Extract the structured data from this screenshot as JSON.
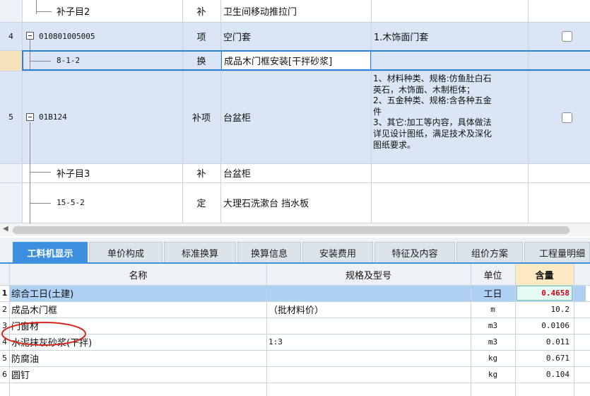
{
  "upper_rows": [
    {
      "index": "",
      "code": "补子目2",
      "type": "补",
      "name": "卫生间移动推拉门",
      "feature": ""
    },
    {
      "index": "4",
      "code": "010801005005",
      "type": "项",
      "name": "空门套",
      "feature": "1.木饰面门套"
    },
    {
      "index": "",
      "code": "8-1-2",
      "type": "换",
      "name": "成品木门框安装[干拌砂浆]",
      "feature": ""
    },
    {
      "index": "5",
      "code": "01B124",
      "type": "补项",
      "name": "台盆柜",
      "feature_lines": [
        "1、材料种类、规格:仿鱼肚白石",
        "英石，木饰面、木制柜体；",
        "2、五金种类、规格:含各种五金",
        "件",
        "3、其它:加工等内容，具体做法",
        "详见设计图纸，满足技术及深化",
        "图纸要求。"
      ]
    },
    {
      "index": "",
      "code": "补子目3",
      "type": "补",
      "name": "台盆柜",
      "feature": ""
    },
    {
      "index": "",
      "code": "15-5-2",
      "type": "定",
      "name": "大理石洗漱台 挡水板",
      "feature": ""
    }
  ],
  "tabs": [
    "工料机显示",
    "单价构成",
    "标准换算",
    "换算信息",
    "安装费用",
    "特征及内容",
    "组价方案",
    "工程量明细"
  ],
  "lower_headers": {
    "name": "名称",
    "spec": "规格及型号",
    "unit": "单位",
    "qty": "含量"
  },
  "lower_rows": [
    {
      "index": "1",
      "name": "综合工日(土建)",
      "spec": "",
      "unit": "工日",
      "qty": "0.4658"
    },
    {
      "index": "2",
      "name": "成品木门框",
      "spec": "（批材料价）",
      "unit": "m",
      "qty": "10.2"
    },
    {
      "index": "3",
      "name": "门窗材",
      "spec": "",
      "unit": "m3",
      "qty": "0.0106"
    },
    {
      "index": "4",
      "name": "水泥抹灰砂浆(干拌)",
      "spec": "1:3",
      "unit": "m3",
      "qty": "0.011"
    },
    {
      "index": "5",
      "name": "防腐油",
      "spec": "",
      "unit": "kg",
      "qty": "0.671"
    },
    {
      "index": "6",
      "name": "圆钉",
      "spec": "",
      "unit": "kg",
      "qty": "0.104"
    }
  ],
  "colors": {
    "selected_row": "#dae6f5",
    "selected_border": "#2a7fe0",
    "tab_active": "#3d8fe0",
    "qty_value": "#d0021b",
    "annotation_ellipse": "#d9261c"
  }
}
